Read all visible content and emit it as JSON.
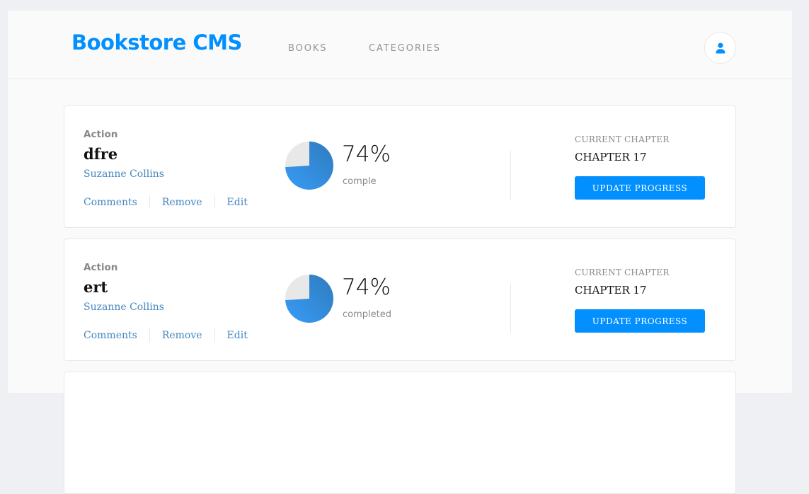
{
  "header": {
    "brand": "Bookstore CMS",
    "nav": [
      {
        "label": "BOOKS"
      },
      {
        "label": "CATEGORIES"
      }
    ],
    "user_icon": "user-icon"
  },
  "colors": {
    "accent": "#0290ff",
    "link": "#4386bf",
    "progress_gradient_start": "#307bbe",
    "progress_gradient_end": "#379cf6",
    "progress_track": "#e8e8e8"
  },
  "books": [
    {
      "genre": "Action",
      "title": "dfre",
      "author": "Suzanne Collins",
      "actions": {
        "comments": "Comments",
        "remove": "Remove",
        "edit": "Edit"
      },
      "progress_percent": 74,
      "percent_label": "74%",
      "completed_label": "comple",
      "chapter_label": "CURRENT CHAPTER",
      "chapter": "CHAPTER 17",
      "update_button": "UPDATE PROGRESS"
    },
    {
      "genre": "Action",
      "title": "ert",
      "author": "Suzanne Collins",
      "actions": {
        "comments": "Comments",
        "remove": "Remove",
        "edit": "Edit"
      },
      "progress_percent": 74,
      "percent_label": "74%",
      "completed_label": "completed",
      "chapter_label": "CURRENT CHAPTER",
      "chapter": "CHAPTER 17",
      "update_button": "UPDATE PROGRESS"
    }
  ]
}
